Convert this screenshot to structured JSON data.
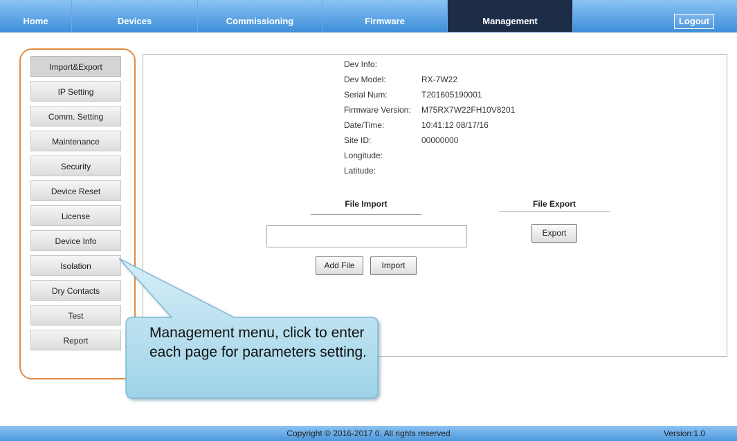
{
  "nav": {
    "tabs": [
      {
        "label": "Home"
      },
      {
        "label": "Devices"
      },
      {
        "label": "Commissioning"
      },
      {
        "label": "Firmware"
      },
      {
        "label": "Management"
      }
    ],
    "active_tab": "Management",
    "logout_label": "Logout"
  },
  "sidebar": {
    "items": [
      {
        "label": "Import&Export"
      },
      {
        "label": "IP Setting"
      },
      {
        "label": "Comm. Setting"
      },
      {
        "label": "Maintenance"
      },
      {
        "label": "Security"
      },
      {
        "label": "Device Reset"
      },
      {
        "label": "License"
      },
      {
        "label": "Device Info"
      },
      {
        "label": "Isolation"
      },
      {
        "label": "Dry Contacts"
      },
      {
        "label": "Test"
      },
      {
        "label": "Report"
      }
    ],
    "active_item": "Import&Export"
  },
  "dev_info": {
    "heading": "Dev Info:",
    "rows": [
      {
        "label": "Dev Model:",
        "value": "RX-7W22"
      },
      {
        "label": "Serial Num:",
        "value": "T201605190001"
      },
      {
        "label": "Firmware Version:",
        "value": "M75RX7W22FH10V8201"
      },
      {
        "label": "Date/Time:",
        "value": "10:41:12 08/17/16"
      },
      {
        "label": "Site ID:",
        "value": "00000000"
      },
      {
        "label": "Longitude:",
        "value": ""
      },
      {
        "label": "Latitude:",
        "value": ""
      }
    ]
  },
  "file_import": {
    "title": "File Import",
    "file_value": "",
    "add_file_label": "Add File",
    "import_label": "Import"
  },
  "file_export": {
    "title": "File Export",
    "export_label": "Export"
  },
  "callout": {
    "text": "Management menu, click to enter each page for parameters setting."
  },
  "footer": {
    "copyright": "Copyright © 2016-2017 0. All rights reserved",
    "version": "Version:1.0"
  },
  "colors": {
    "nav_active": "#1d2d48",
    "nav_gradient_top": "#8cc3f2",
    "nav_gradient_bottom": "#3d8fda",
    "highlight_border": "#e38a3f",
    "callout_fill": "#b6dfee"
  }
}
